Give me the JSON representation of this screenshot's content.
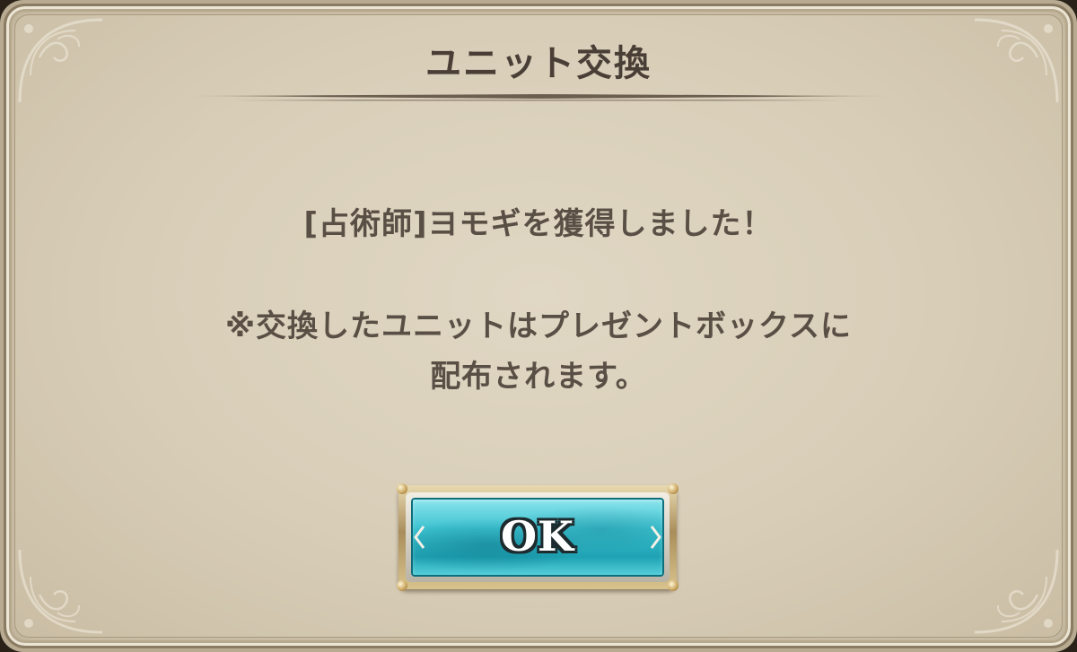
{
  "dialog": {
    "title": "ユニット交換",
    "message_line1": "[占術師]ヨモギを獲得しました！",
    "message_line2": "※交換したユニットはプレゼントボックスに",
    "message_line3": "配布されます。",
    "ok_button_label": "OK"
  },
  "colors": {
    "panel": "#d8ceb8",
    "frame": "#8a7c62",
    "text": "#5a4f45",
    "title_text": "#4a3f36",
    "button_face": "#3cc2d0",
    "button_frame": "#a98e5c"
  },
  "icons": {
    "corner_ornament": "corner-flourish-icon",
    "button_arrow": "chevron-icon"
  }
}
